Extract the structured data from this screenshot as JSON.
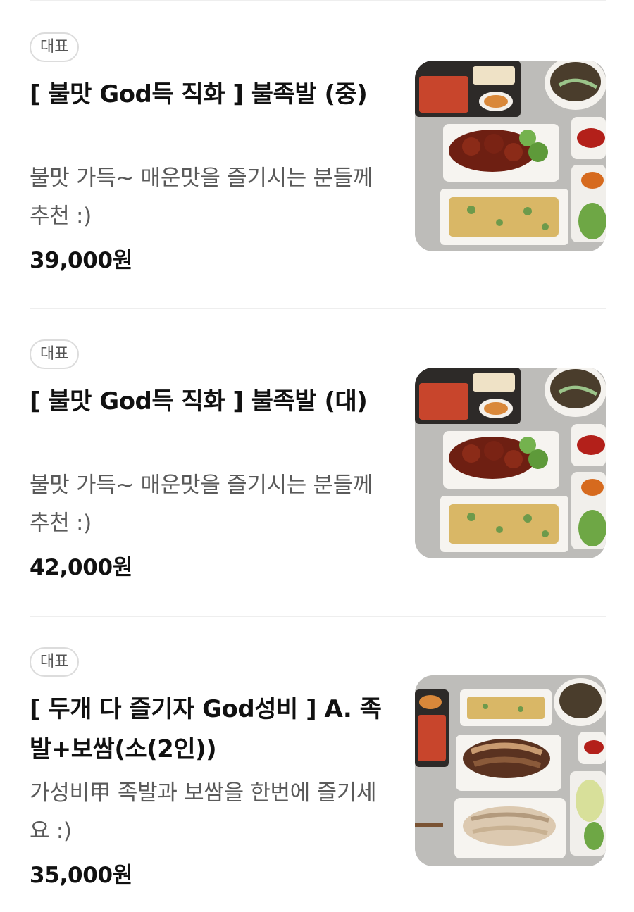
{
  "menu_items": [
    {
      "badge": "대표",
      "title": "[ 불맛 God득 직화 ] 불족발 (중)",
      "description": "불맛 가득~ 매운맛을 즐기시는 분들께 추천 :)",
      "price": "39,000원",
      "image": "spicy-jokbal-platter-photo"
    },
    {
      "badge": "대표",
      "title": "[ 불맛 God득 직화 ] 불족발 (대)",
      "description": "불맛 가득~ 매운맛을 즐기시는 분들께 추천 :)",
      "price": "42,000원",
      "image": "spicy-jokbal-platter-photo"
    },
    {
      "badge": "대표",
      "title": "[ 두개 다 즐기자 God성비 ] A. 족발+보쌈(소(2인))",
      "description": "가성비甲 족발과 보쌈을 한번에 즐기세요 :)",
      "price": "35,000원",
      "image": "jokbal-bossam-platter-photo"
    }
  ],
  "colors": {
    "divider": "#eeeeee",
    "badge_border": "#dcdcdc",
    "title": "#111111",
    "description": "#5a5a5a"
  }
}
